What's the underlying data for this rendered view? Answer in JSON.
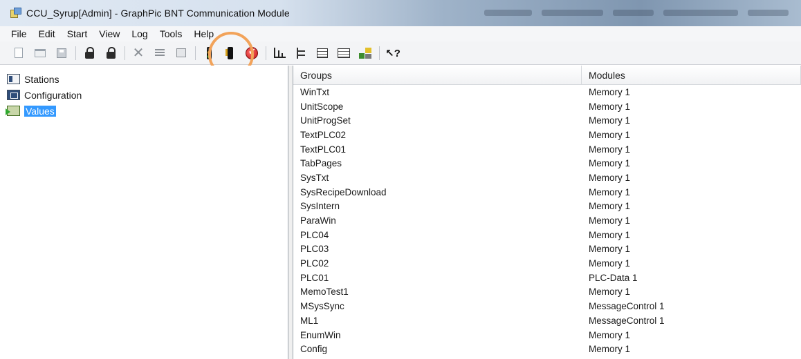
{
  "window": {
    "title": "CCU_Syrup[Admin] - GraphPic BNT Communication Module"
  },
  "menu": [
    "File",
    "Edit",
    "Start",
    "View",
    "Log",
    "Tools",
    "Help"
  ],
  "toolbar_icons": [
    "new-document-icon",
    "open-icon",
    "save-icon",
    "lock-icon",
    "unlock-icon",
    "delete-icon",
    "properties-icon",
    "document-icon",
    "traffic-light-icon",
    "stoplight-icon",
    "check-icon",
    "chart-icon",
    "tree-view-icon",
    "list-view-icon",
    "detail-view-icon",
    "modules-icon",
    "help-icon"
  ],
  "highlight_color": "#f2a35a",
  "tree": {
    "items": [
      {
        "label": "Stations"
      },
      {
        "label": "Configuration"
      },
      {
        "label": "Values"
      }
    ],
    "selected": "Values"
  },
  "list": {
    "columns": [
      "Groups",
      "Modules"
    ],
    "rows": [
      {
        "group": "WinTxt",
        "module": "Memory 1"
      },
      {
        "group": "UnitScope",
        "module": "Memory 1"
      },
      {
        "group": "UnitProgSet",
        "module": "Memory 1"
      },
      {
        "group": "TextPLC02",
        "module": "Memory 1"
      },
      {
        "group": "TextPLC01",
        "module": "Memory 1"
      },
      {
        "group": "TabPages",
        "module": "Memory 1"
      },
      {
        "group": "SysTxt",
        "module": "Memory 1"
      },
      {
        "group": "SysRecipeDownload",
        "module": "Memory 1"
      },
      {
        "group": "SysIntern",
        "module": "Memory 1"
      },
      {
        "group": "ParaWin",
        "module": "Memory 1"
      },
      {
        "group": "PLC04",
        "module": "Memory 1"
      },
      {
        "group": "PLC03",
        "module": "Memory 1"
      },
      {
        "group": "PLC02",
        "module": "Memory 1"
      },
      {
        "group": "PLC01",
        "module": "PLC-Data 1"
      },
      {
        "group": "MemoTest1",
        "module": "Memory 1"
      },
      {
        "group": "MSysSync",
        "module": "MessageControl 1"
      },
      {
        "group": "ML1",
        "module": "MessageControl 1"
      },
      {
        "group": "EnumWin",
        "module": "Memory 1"
      },
      {
        "group": "Config",
        "module": "Memory 1"
      }
    ]
  }
}
